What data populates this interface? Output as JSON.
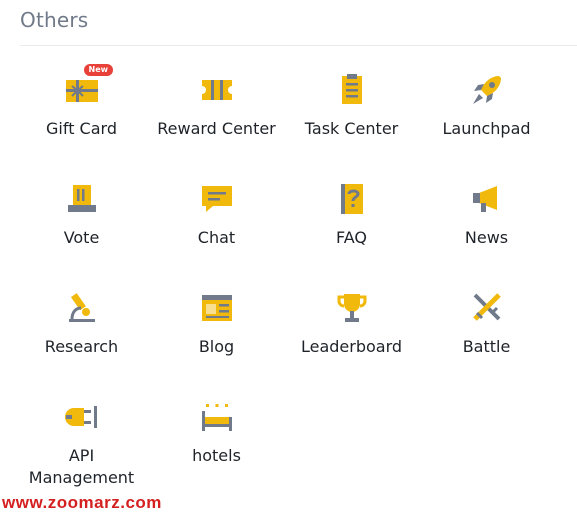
{
  "section": {
    "title": "Others"
  },
  "tiles": [
    {
      "label": "Gift Card",
      "badge": "New",
      "icon": "gift-card-icon"
    },
    {
      "label": "Reward Center",
      "icon": "ticket-icon"
    },
    {
      "label": "Task Center",
      "icon": "clipboard-icon"
    },
    {
      "label": "Launchpad",
      "icon": "rocket-icon"
    },
    {
      "label": "Vote",
      "icon": "ballot-box-icon"
    },
    {
      "label": "Chat",
      "icon": "chat-bubble-icon"
    },
    {
      "label": "FAQ",
      "icon": "question-book-icon"
    },
    {
      "label": "News",
      "icon": "megaphone-icon"
    },
    {
      "label": "Research",
      "icon": "microscope-icon"
    },
    {
      "label": "Blog",
      "icon": "newspaper-icon"
    },
    {
      "label": "Leaderboard",
      "icon": "trophy-icon"
    },
    {
      "label": "Battle",
      "icon": "crossed-swords-icon"
    },
    {
      "label": "API Management",
      "icon": "plug-icon"
    },
    {
      "label": "hotels",
      "icon": "bed-icon"
    }
  ],
  "watermark": "www.zoomarz.com",
  "colors": {
    "yellow": "#f0b90b",
    "gray": "#707a8a",
    "badge": "#e8413a"
  }
}
